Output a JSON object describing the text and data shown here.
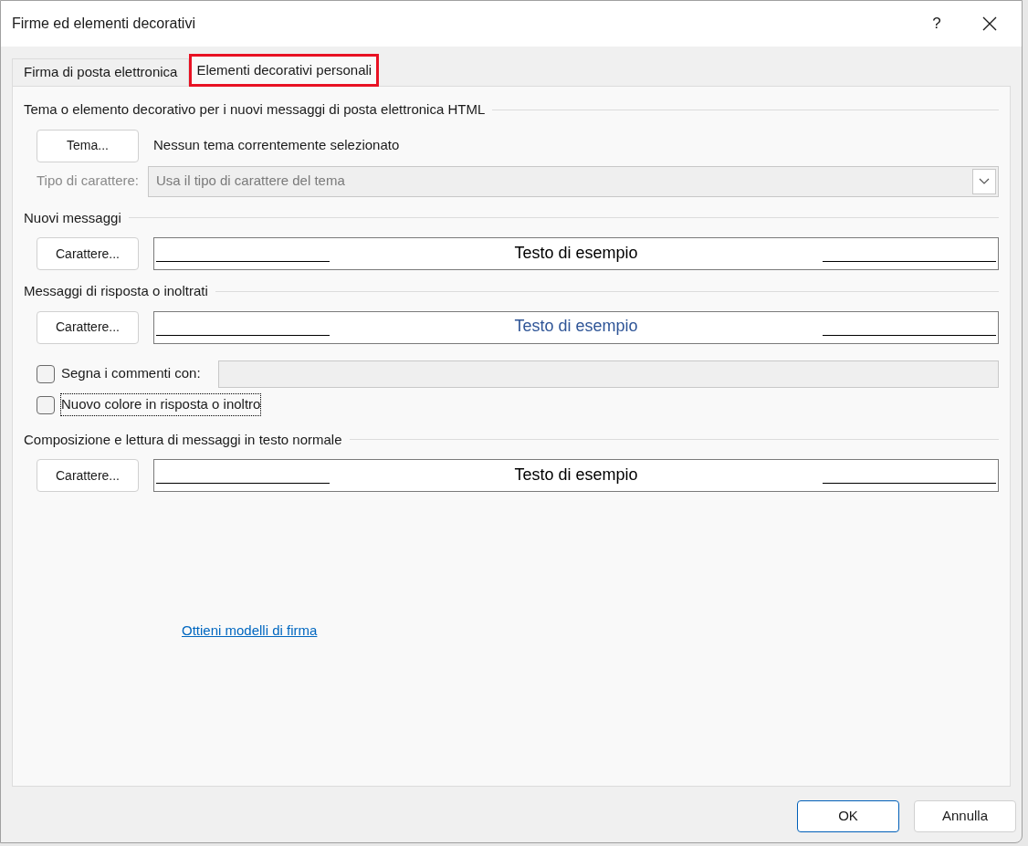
{
  "window": {
    "title": "Firme ed elementi decorativi",
    "help": "?"
  },
  "tabs": [
    {
      "label": "Firma di posta elettronica",
      "selected": false
    },
    {
      "label": "Elementi decorativi personali",
      "selected": true
    }
  ],
  "theme_section": {
    "title": "Tema o elemento decorativo per i nuovi messaggi di posta elettronica HTML",
    "button": "Tema...",
    "status": "Nessun tema correntemente selezionato",
    "font_label": "Tipo di carattere:",
    "font_value": "Usa il tipo di carattere del tema",
    "font_disabled": true
  },
  "new_messages": {
    "title": "Nuovi messaggi",
    "button": "Carattere...",
    "preview": {
      "text": "Testo di esempio",
      "color": "#000000"
    }
  },
  "replies": {
    "title": "Messaggi di risposta o inoltrati",
    "button": "Carattere...",
    "preview": {
      "text": "Testo di esempio",
      "color": "#2f5597"
    },
    "options": [
      {
        "kind": "field",
        "label": "Segna i commenti con:",
        "checked": false,
        "focused": false
      },
      {
        "kind": "plain",
        "label": "Nuovo colore in risposta o inoltro",
        "checked": false,
        "focused": true
      }
    ]
  },
  "plain_text": {
    "title": "Composizione e lettura di messaggi in testo normale",
    "button": "Carattere...",
    "preview": {
      "text": "Testo di esempio",
      "color": "#000000"
    }
  },
  "link": "Ottieni modelli di firma",
  "buttons": [
    {
      "label": "OK",
      "default": true
    },
    {
      "label": "Annulla",
      "default": false
    }
  ]
}
